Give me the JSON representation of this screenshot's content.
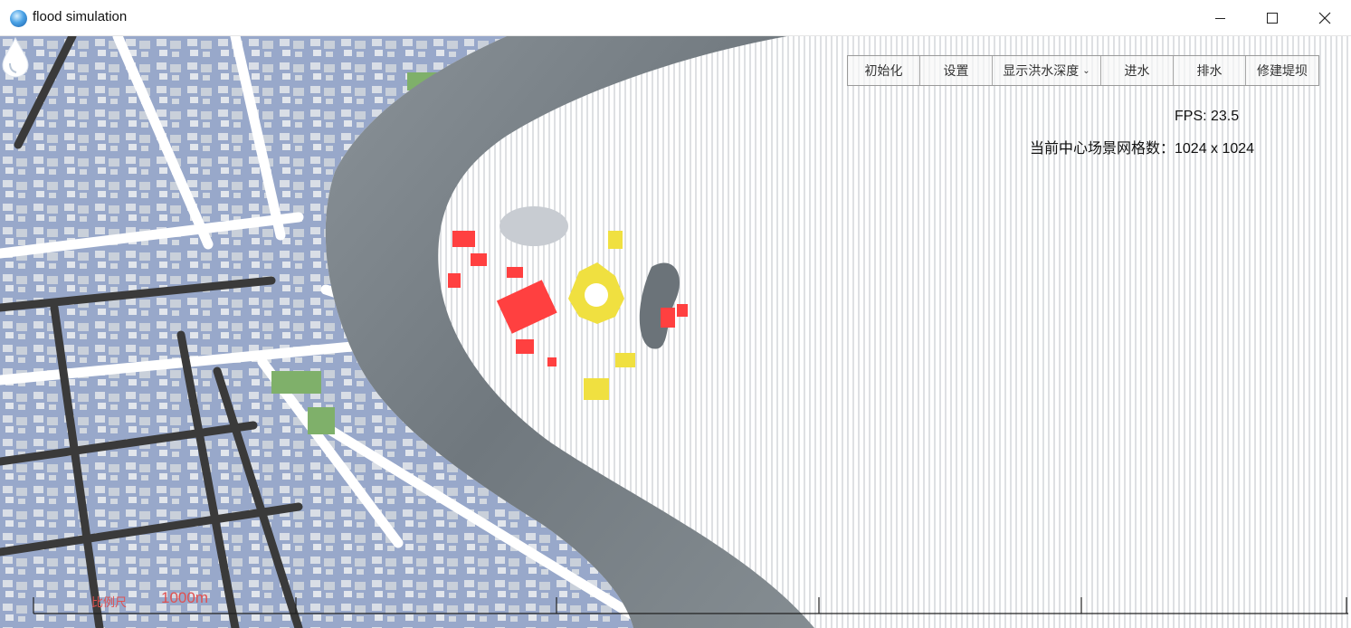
{
  "window": {
    "title": "flood simulation",
    "icon": "water-globe-icon"
  },
  "toolbar": {
    "buttons": [
      {
        "label": "初始化"
      },
      {
        "label": "设置"
      },
      {
        "label": "显示洪水深度"
      },
      {
        "label": "进水"
      },
      {
        "label": "排水"
      },
      {
        "label": "修建堤坝"
      }
    ]
  },
  "stats": {
    "fps": "FPS: 23.5",
    "grid": "当前中心场景网格数：1024 x 1024"
  },
  "scale": {
    "label": "比例尺",
    "value": "1000m"
  },
  "colors": {
    "river": "#6b7379",
    "city_blocks": "#97a7c9",
    "roads": "#ffffff",
    "dark_roads": "#3a3a3a",
    "flood_buildings_high": "#ff4040",
    "flood_buildings_mid": "#f0e040",
    "park": "#7fb06a"
  }
}
